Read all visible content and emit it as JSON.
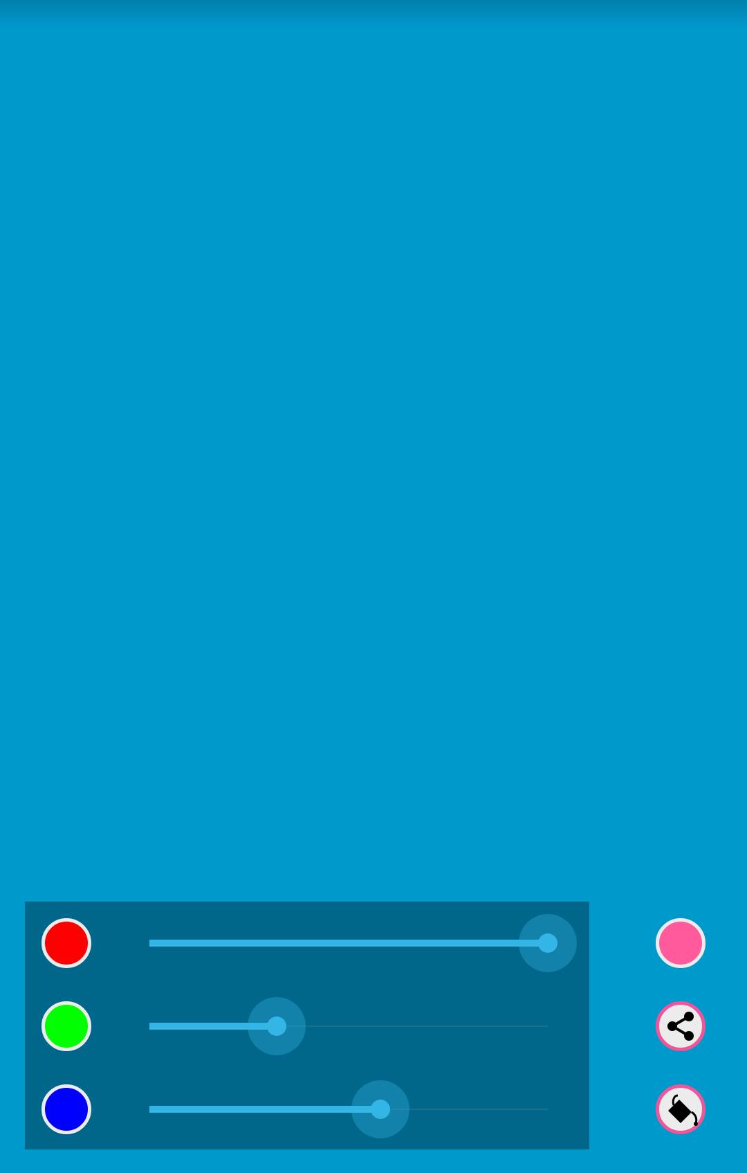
{
  "colors": {
    "background": "#0099CC",
    "panel": "#00678A",
    "accent": "#33B5E5",
    "pink": "#FF5A9B"
  },
  "sliders": [
    {
      "name": "red",
      "swatch_color": "#FF0000",
      "value": 1.0
    },
    {
      "name": "green",
      "swatch_color": "#00FF00",
      "value": 0.32
    },
    {
      "name": "blue",
      "swatch_color": "#0000FF",
      "value": 0.58
    }
  ],
  "side_buttons": {
    "preview": {
      "icon": "color-preview-icon",
      "color": "#FF5A9B"
    },
    "share": {
      "icon": "share-icon"
    },
    "fill": {
      "icon": "paint-bucket-icon"
    }
  }
}
